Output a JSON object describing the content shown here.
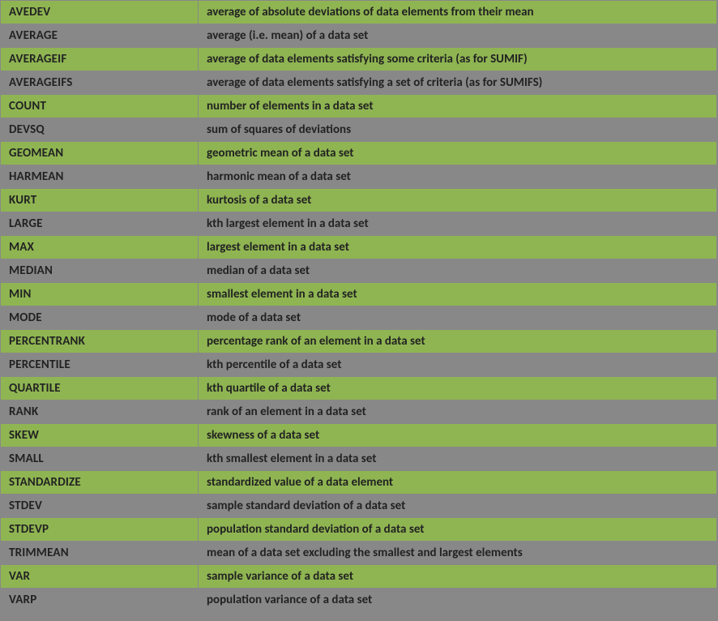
{
  "rows": [
    {
      "fn": "AVEDEV",
      "desc": "average of absolute deviations of data elements from their mean"
    },
    {
      "fn": "AVERAGE",
      "desc": "average (i.e. mean) of a data set"
    },
    {
      "fn": "AVERAGEIF",
      "desc": "average of data elements satisfying some criteria (as for SUMIF)"
    },
    {
      "fn": "AVERAGEIFS",
      "desc": "average of data elements satisfying a set of criteria (as for SUMIFS)"
    },
    {
      "fn": "COUNT",
      "desc": "number of elements in a data set"
    },
    {
      "fn": "DEVSQ",
      "desc": "sum of squares of deviations"
    },
    {
      "fn": "GEOMEAN",
      "desc": "geometric mean of a data set"
    },
    {
      "fn": "HARMEAN",
      "desc": "harmonic mean of a data set"
    },
    {
      "fn": "KURT",
      "desc": "kurtosis of a data set"
    },
    {
      "fn": "LARGE",
      "desc": "kth largest element in a data set"
    },
    {
      "fn": "MAX",
      "desc": "largest element in a data set"
    },
    {
      "fn": "MEDIAN",
      "desc": "median of a data set"
    },
    {
      "fn": "MIN",
      "desc": "smallest element in a data set"
    },
    {
      "fn": "MODE",
      "desc": "mode of a data set"
    },
    {
      "fn": "PERCENTRANK",
      "desc": "percentage rank of an element in a data set"
    },
    {
      "fn": "PERCENTILE",
      "desc": "kth percentile of a data set"
    },
    {
      "fn": "QUARTILE",
      "desc": "kth quartile of a data set"
    },
    {
      "fn": "RANK",
      "desc": "rank of an element in a data set"
    },
    {
      "fn": "SKEW",
      "desc": "skewness of a data set"
    },
    {
      "fn": "SMALL",
      "desc": "kth smallest element in a data set"
    },
    {
      "fn": "STANDARDIZE",
      "desc": "standardized value of a data element"
    },
    {
      "fn": "STDEV",
      "desc": "sample standard deviation of a data set"
    },
    {
      "fn": "STDEVP",
      "desc": "population standard deviation of a data set"
    },
    {
      "fn": "TRIMMEAN",
      "desc": "mean of a data set excluding the smallest and largest elements"
    },
    {
      "fn": "VAR",
      "desc": "sample variance of a data set"
    },
    {
      "fn": "VARP",
      "desc": "population variance of a data set"
    }
  ],
  "colors": {
    "green": "#8fb552",
    "grey": "#888888"
  }
}
